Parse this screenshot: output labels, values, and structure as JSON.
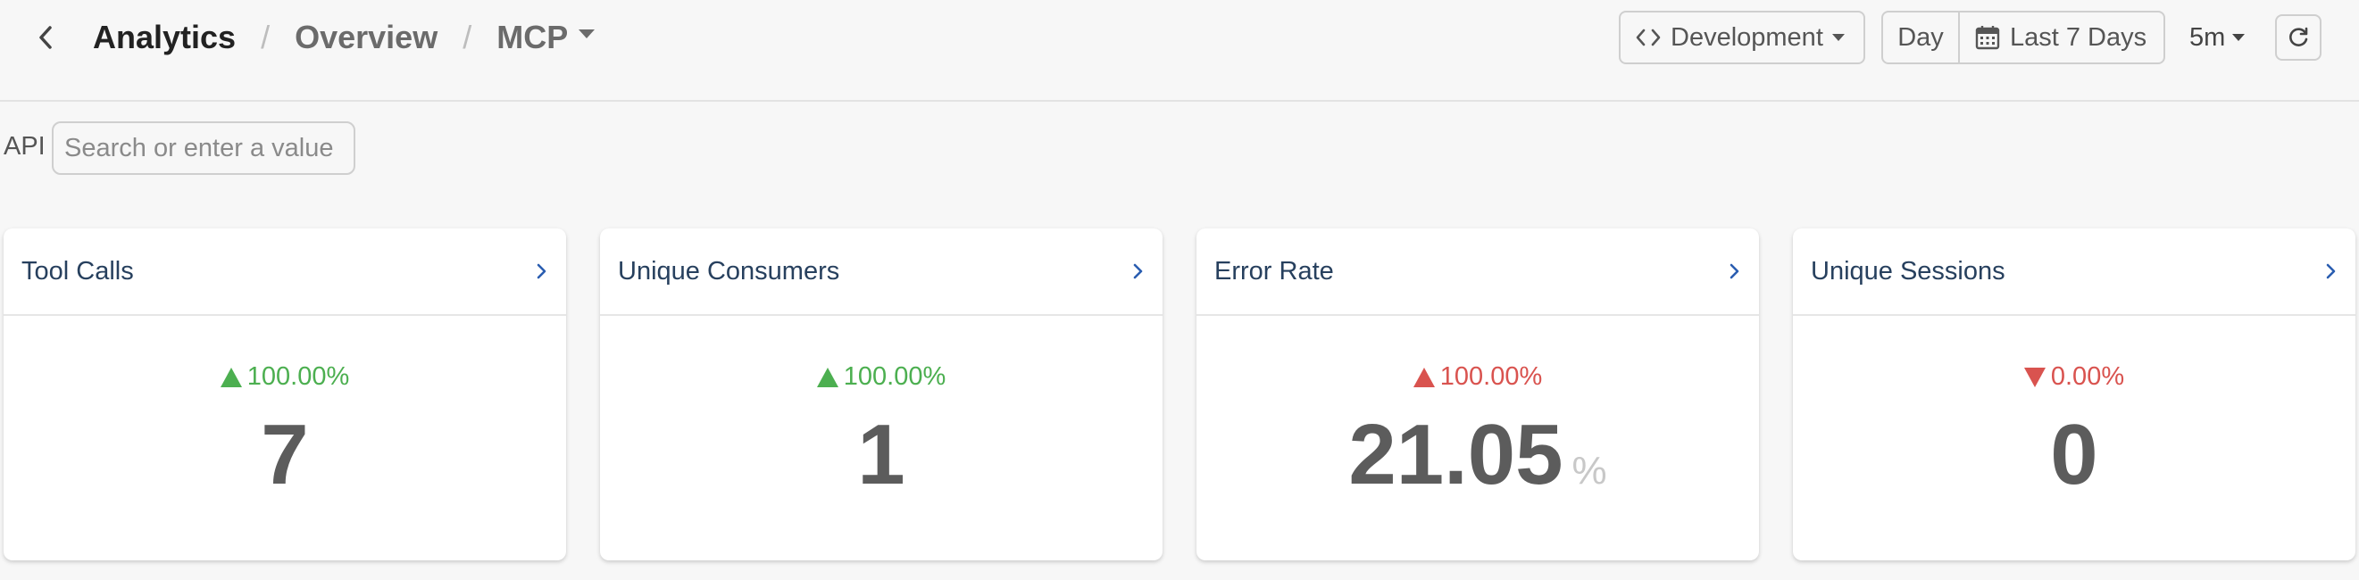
{
  "colors": {
    "positive": "#4caf50",
    "negative": "#d9534f",
    "link": "#2a5db0"
  },
  "header": {
    "back_icon": "chevron-left-icon",
    "breadcrumb": {
      "root": "Analytics",
      "sep1": "/",
      "middle": "Overview",
      "sep2": "/",
      "current": "MCP"
    },
    "environment": {
      "icon": "code-icon",
      "label": "Development"
    },
    "range": {
      "unit": "Day",
      "icon": "calendar-icon",
      "label": "Last 7 Days"
    },
    "refresh_interval": "5m",
    "refresh_icon": "refresh-icon"
  },
  "filter": {
    "label": "API",
    "placeholder": "Search or enter a value",
    "value": ""
  },
  "cards": [
    {
      "title": "Tool Calls",
      "delta": "100.00%",
      "direction": "up",
      "trend": "positive",
      "value": "7",
      "unit": ""
    },
    {
      "title": "Unique Consumers",
      "delta": "100.00%",
      "direction": "up",
      "trend": "positive",
      "value": "1",
      "unit": ""
    },
    {
      "title": "Error Rate",
      "delta": "100.00%",
      "direction": "up",
      "trend": "negative",
      "value": "21.05",
      "unit": "%"
    },
    {
      "title": "Unique Sessions",
      "delta": "0.00%",
      "direction": "down",
      "trend": "negative",
      "value": "0",
      "unit": ""
    }
  ]
}
